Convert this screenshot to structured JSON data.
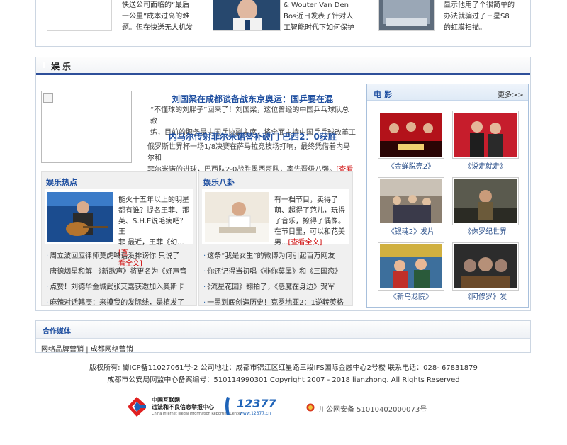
{
  "top_cards": [
    {
      "text_line1": "快送公司面临的“最后",
      "text_line2": "一公里”成本过高的难",
      "text_line3": "题。但在快送无人机发"
    },
    {
      "text_line1": "& Wouter Van Den",
      "text_line2": "Bos近日发表了针对人",
      "text_line3": "工智能时代下如何保护"
    },
    {
      "text_line1": "显示他用了个很简单的",
      "text_line2": "办法就骗过了三星S8",
      "text_line3": "的虹膜扫描。"
    }
  ],
  "section": {
    "title": "娱乐"
  },
  "headline1": {
    "title": "刘国梁在成都谈备战东京奥运：国乒要在混",
    "lead_line1": "“不懂球的刘胖子”回来了！刘国梁，这位曾经的中国乒乓球队总教",
    "lead_line2": "练，目前的职务是中国乒协副主席，将全面主持中国乒乓球改革工"
  },
  "headline2": {
    "title": "内马尔传射菲尔米诺替补破门 巴西2：0获胜",
    "lead_line1": "俄罗斯世界杯一场1/8决赛在萨马拉竞技场打响，最终凭借着内马尔和",
    "lead_line2": "菲尔米诺的进球，巴西队2-0战胜墨西哥队，率先晋级八强。",
    "more": "[查看全"
  },
  "hot": {
    "title": "娱乐热点",
    "feature_line1": "能火十五年以上的明星",
    "feature_line2": "都有谁？提名王菲、那",
    "feature_line3": "英、S.H.E说毛病吧？王",
    "feature_line4": "菲 最近，王菲《幻...",
    "more1": "[查",
    "more2": "看全文]",
    "items": [
      "周立波回应律师莫虎喊话没排谤你 只说了",
      "唐德烟星和解 《新歌声》将更名为《好声音",
      "点赞！刘德华金城武张艾嘉获邀加入奥斯卡",
      "麻辣对话韩庚：来摸我的发际线，是植发了"
    ]
  },
  "gossip": {
    "title": "娱乐八卦",
    "feature_line1": "有一档节目，卖得了",
    "feature_line2": "萌、超得了范儿，玩得",
    "feature_line3": "了音乐，撩得了偶像。",
    "feature_line4": "在节目里，可以和花美",
    "feature_line5": "男...",
    "more": "[查看全文]",
    "items": [
      "这条“我是女生”的微博为何引起百万网友",
      "你还记得当初唱《非你莫属》和《三国恋》",
      "《流星花园》翻拍了，《恶魔在身边》贺军",
      "一黑到底创造历史！克罗地亚2：1逆转英格"
    ]
  },
  "movies": {
    "title": "电影",
    "more": "更多>>",
    "items": [
      {
        "caption": "《金蝉脱壳2》"
      },
      {
        "caption": "《说走就走》"
      },
      {
        "caption": "《银魂2》发片"
      },
      {
        "caption": "《侏罗纪世界"
      },
      {
        "caption": "《新乌龙院》"
      },
      {
        "caption": "《阿修罗》发"
      }
    ]
  },
  "partners": {
    "title": "合作媒体",
    "links": [
      "网络品牌营销",
      "成都网络营销"
    ],
    "separator": "|"
  },
  "footer": {
    "line1": "版权所有: 蜀ICP备11027061号-2 公司地址：成都市锦江区红星路三段IFS国际金融中心2号楼 联系电话：028- 67831879",
    "line2": "成都市公安局网监中心备案编号：510114990301  Copyright 2007 - 2018 lianzhong. All Rights Reserved",
    "badge1_title": "中国互联网",
    "badge1_sub": "违法和不良信息举报中心",
    "badge1_en": "China Internet Illegal Information Reporting Center",
    "badge2_num": "12377",
    "badge2_url": "www.12377.cn",
    "police": "川公网安备 51010402000073号"
  },
  "colors": {
    "accent": "#2e4f9a",
    "headline": "#1f4fa0",
    "more_red": "#cc0000"
  }
}
